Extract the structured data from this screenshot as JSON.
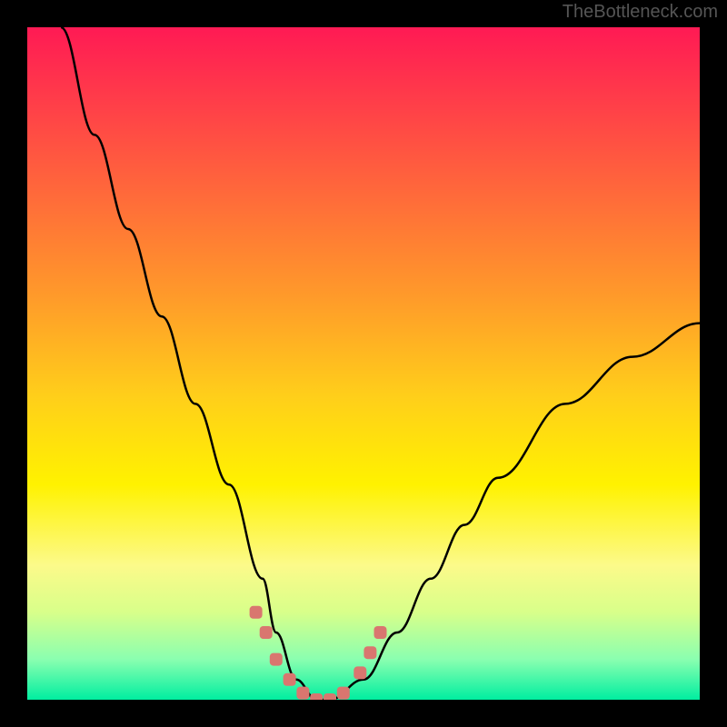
{
  "watermark": "TheBottleneck.com",
  "chart_data": {
    "type": "line",
    "title": "",
    "xlabel": "",
    "ylabel": "",
    "xlim": [
      0,
      100
    ],
    "ylim": [
      0,
      100
    ],
    "series": [
      {
        "name": "curve",
        "x": [
          5,
          10,
          15,
          20,
          25,
          30,
          35,
          37,
          40,
          43,
          45,
          50,
          55,
          60,
          65,
          70,
          80,
          90,
          100
        ],
        "values": [
          100,
          84,
          70,
          57,
          44,
          32,
          18,
          10,
          3,
          0,
          0,
          3,
          10,
          18,
          26,
          33,
          44,
          51,
          56
        ]
      }
    ],
    "markers": {
      "name": "highlight-dots",
      "color": "#d9766f",
      "x": [
        34,
        35.5,
        37,
        39,
        41,
        43,
        45,
        47,
        49.5,
        51,
        52.5
      ],
      "values": [
        13,
        10,
        6,
        3,
        1,
        0,
        0,
        1,
        4,
        7,
        10
      ]
    }
  }
}
